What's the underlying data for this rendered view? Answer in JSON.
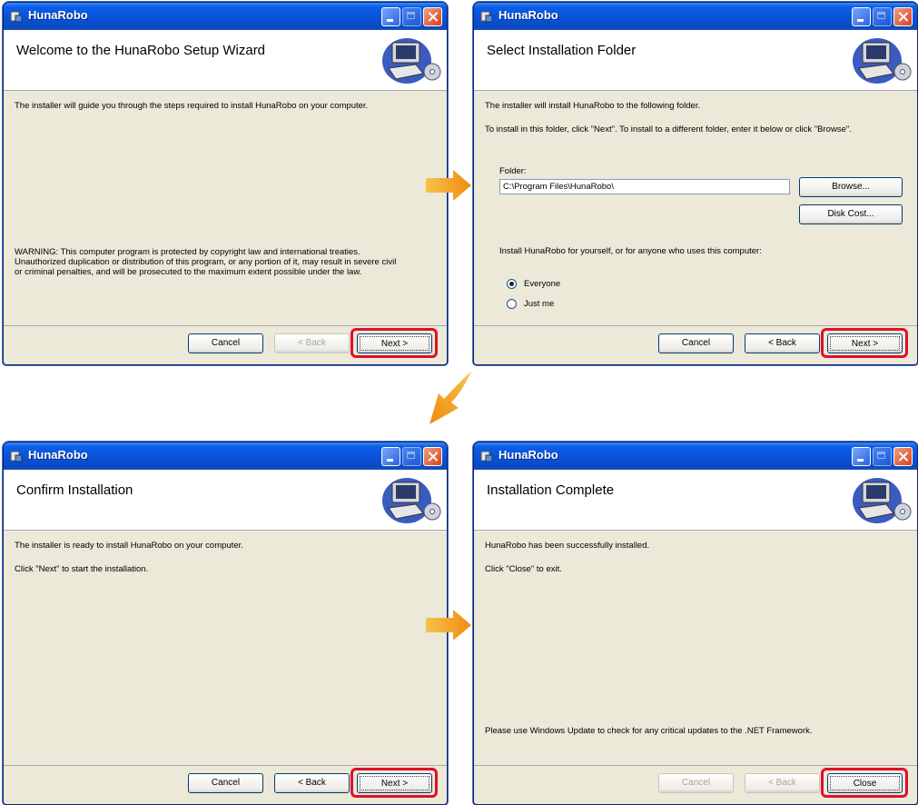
{
  "app_title": "HunaRobo",
  "window_controls": {
    "minimize": "minimize-icon",
    "maximize": "maximize-icon",
    "close": "close-icon"
  },
  "buttons": {
    "cancel": "Cancel",
    "back": "< Back",
    "next": "Next >",
    "close": "Close",
    "browse": "Browse...",
    "disk_cost": "Disk Cost..."
  },
  "colors": {
    "title_bar": "#0852d8",
    "window_bg": "#ece9d8",
    "highlight": "#e0102a",
    "arrow": "#f39a1e"
  },
  "step1": {
    "heading": "Welcome to the HunaRobo Setup Wizard",
    "intro": "The installer will guide you through the steps required to install HunaRobo on your computer.",
    "warning_line1": "WARNING: This computer program is protected by copyright law and international treaties.",
    "warning_line2": "Unauthorized duplication or distribution of this program, or any portion of it, may result in severe civil",
    "warning_line3": "or criminal penalties, and will be prosecuted to the maximum extent possible under the law.",
    "back_enabled": false
  },
  "step2": {
    "heading": "Select Installation Folder",
    "line1": "The installer will install HunaRobo to the following folder.",
    "line2": "To install in this folder, click \"Next\". To install to a different folder, enter it below or click \"Browse\".",
    "folder_label": "Folder:",
    "folder_value": "C:\\Program Files\\HunaRobo\\",
    "install_for": "Install HunaRobo for yourself, or for anyone who uses this computer:",
    "option_everyone": "Everyone",
    "option_just_me": "Just me",
    "selected_option": "Everyone"
  },
  "step3": {
    "heading": "Confirm Installation",
    "line1": "The installer is ready to install HunaRobo on your computer.",
    "line2": "Click \"Next\" to start the installation."
  },
  "step4": {
    "heading": "Installation Complete",
    "line1": "HunaRobo has been successfully installed.",
    "line2": "Click \"Close\" to exit.",
    "note": "Please use Windows Update to check for any critical updates to the .NET Framework.",
    "cancel_enabled": false,
    "back_enabled": false
  }
}
